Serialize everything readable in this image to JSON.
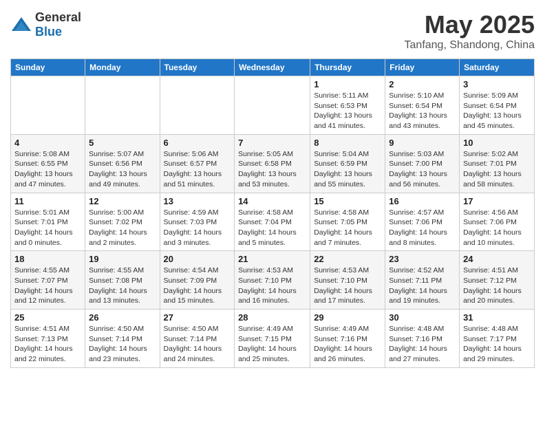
{
  "header": {
    "logo_general": "General",
    "logo_blue": "Blue",
    "month_year": "May 2025",
    "location": "Tanfang, Shandong, China"
  },
  "weekdays": [
    "Sunday",
    "Monday",
    "Tuesday",
    "Wednesday",
    "Thursday",
    "Friday",
    "Saturday"
  ],
  "weeks": [
    [
      {
        "day": "",
        "sunrise": "",
        "sunset": "",
        "daylight": ""
      },
      {
        "day": "",
        "sunrise": "",
        "sunset": "",
        "daylight": ""
      },
      {
        "day": "",
        "sunrise": "",
        "sunset": "",
        "daylight": ""
      },
      {
        "day": "",
        "sunrise": "",
        "sunset": "",
        "daylight": ""
      },
      {
        "day": "1",
        "sunrise": "Sunrise: 5:11 AM",
        "sunset": "Sunset: 6:53 PM",
        "daylight": "Daylight: 13 hours and 41 minutes."
      },
      {
        "day": "2",
        "sunrise": "Sunrise: 5:10 AM",
        "sunset": "Sunset: 6:54 PM",
        "daylight": "Daylight: 13 hours and 43 minutes."
      },
      {
        "day": "3",
        "sunrise": "Sunrise: 5:09 AM",
        "sunset": "Sunset: 6:54 PM",
        "daylight": "Daylight: 13 hours and 45 minutes."
      }
    ],
    [
      {
        "day": "4",
        "sunrise": "Sunrise: 5:08 AM",
        "sunset": "Sunset: 6:55 PM",
        "daylight": "Daylight: 13 hours and 47 minutes."
      },
      {
        "day": "5",
        "sunrise": "Sunrise: 5:07 AM",
        "sunset": "Sunset: 6:56 PM",
        "daylight": "Daylight: 13 hours and 49 minutes."
      },
      {
        "day": "6",
        "sunrise": "Sunrise: 5:06 AM",
        "sunset": "Sunset: 6:57 PM",
        "daylight": "Daylight: 13 hours and 51 minutes."
      },
      {
        "day": "7",
        "sunrise": "Sunrise: 5:05 AM",
        "sunset": "Sunset: 6:58 PM",
        "daylight": "Daylight: 13 hours and 53 minutes."
      },
      {
        "day": "8",
        "sunrise": "Sunrise: 5:04 AM",
        "sunset": "Sunset: 6:59 PM",
        "daylight": "Daylight: 13 hours and 55 minutes."
      },
      {
        "day": "9",
        "sunrise": "Sunrise: 5:03 AM",
        "sunset": "Sunset: 7:00 PM",
        "daylight": "Daylight: 13 hours and 56 minutes."
      },
      {
        "day": "10",
        "sunrise": "Sunrise: 5:02 AM",
        "sunset": "Sunset: 7:01 PM",
        "daylight": "Daylight: 13 hours and 58 minutes."
      }
    ],
    [
      {
        "day": "11",
        "sunrise": "Sunrise: 5:01 AM",
        "sunset": "Sunset: 7:01 PM",
        "daylight": "Daylight: 14 hours and 0 minutes."
      },
      {
        "day": "12",
        "sunrise": "Sunrise: 5:00 AM",
        "sunset": "Sunset: 7:02 PM",
        "daylight": "Daylight: 14 hours and 2 minutes."
      },
      {
        "day": "13",
        "sunrise": "Sunrise: 4:59 AM",
        "sunset": "Sunset: 7:03 PM",
        "daylight": "Daylight: 14 hours and 3 minutes."
      },
      {
        "day": "14",
        "sunrise": "Sunrise: 4:58 AM",
        "sunset": "Sunset: 7:04 PM",
        "daylight": "Daylight: 14 hours and 5 minutes."
      },
      {
        "day": "15",
        "sunrise": "Sunrise: 4:58 AM",
        "sunset": "Sunset: 7:05 PM",
        "daylight": "Daylight: 14 hours and 7 minutes."
      },
      {
        "day": "16",
        "sunrise": "Sunrise: 4:57 AM",
        "sunset": "Sunset: 7:06 PM",
        "daylight": "Daylight: 14 hours and 8 minutes."
      },
      {
        "day": "17",
        "sunrise": "Sunrise: 4:56 AM",
        "sunset": "Sunset: 7:06 PM",
        "daylight": "Daylight: 14 hours and 10 minutes."
      }
    ],
    [
      {
        "day": "18",
        "sunrise": "Sunrise: 4:55 AM",
        "sunset": "Sunset: 7:07 PM",
        "daylight": "Daylight: 14 hours and 12 minutes."
      },
      {
        "day": "19",
        "sunrise": "Sunrise: 4:55 AM",
        "sunset": "Sunset: 7:08 PM",
        "daylight": "Daylight: 14 hours and 13 minutes."
      },
      {
        "day": "20",
        "sunrise": "Sunrise: 4:54 AM",
        "sunset": "Sunset: 7:09 PM",
        "daylight": "Daylight: 14 hours and 15 minutes."
      },
      {
        "day": "21",
        "sunrise": "Sunrise: 4:53 AM",
        "sunset": "Sunset: 7:10 PM",
        "daylight": "Daylight: 14 hours and 16 minutes."
      },
      {
        "day": "22",
        "sunrise": "Sunrise: 4:53 AM",
        "sunset": "Sunset: 7:10 PM",
        "daylight": "Daylight: 14 hours and 17 minutes."
      },
      {
        "day": "23",
        "sunrise": "Sunrise: 4:52 AM",
        "sunset": "Sunset: 7:11 PM",
        "daylight": "Daylight: 14 hours and 19 minutes."
      },
      {
        "day": "24",
        "sunrise": "Sunrise: 4:51 AM",
        "sunset": "Sunset: 7:12 PM",
        "daylight": "Daylight: 14 hours and 20 minutes."
      }
    ],
    [
      {
        "day": "25",
        "sunrise": "Sunrise: 4:51 AM",
        "sunset": "Sunset: 7:13 PM",
        "daylight": "Daylight: 14 hours and 22 minutes."
      },
      {
        "day": "26",
        "sunrise": "Sunrise: 4:50 AM",
        "sunset": "Sunset: 7:14 PM",
        "daylight": "Daylight: 14 hours and 23 minutes."
      },
      {
        "day": "27",
        "sunrise": "Sunrise: 4:50 AM",
        "sunset": "Sunset: 7:14 PM",
        "daylight": "Daylight: 14 hours and 24 minutes."
      },
      {
        "day": "28",
        "sunrise": "Sunrise: 4:49 AM",
        "sunset": "Sunset: 7:15 PM",
        "daylight": "Daylight: 14 hours and 25 minutes."
      },
      {
        "day": "29",
        "sunrise": "Sunrise: 4:49 AM",
        "sunset": "Sunset: 7:16 PM",
        "daylight": "Daylight: 14 hours and 26 minutes."
      },
      {
        "day": "30",
        "sunrise": "Sunrise: 4:48 AM",
        "sunset": "Sunset: 7:16 PM",
        "daylight": "Daylight: 14 hours and 27 minutes."
      },
      {
        "day": "31",
        "sunrise": "Sunrise: 4:48 AM",
        "sunset": "Sunset: 7:17 PM",
        "daylight": "Daylight: 14 hours and 29 minutes."
      }
    ]
  ]
}
